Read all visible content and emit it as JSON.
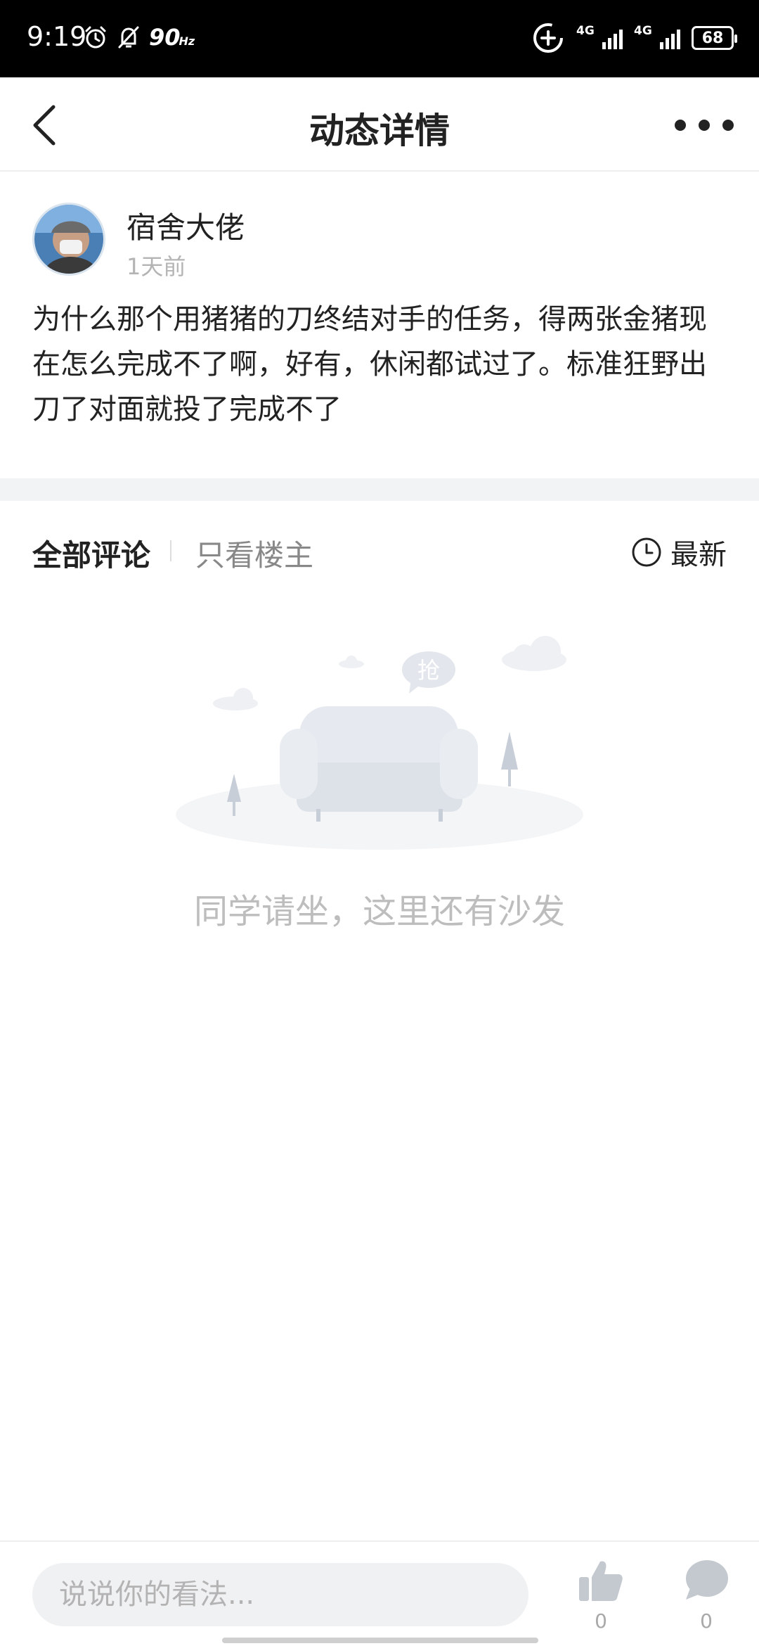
{
  "status_bar": {
    "time": "9:19",
    "refresh_rate": "90",
    "refresh_unit": "Hz",
    "network_1": "4G",
    "network_2": "4G",
    "battery": "68",
    "icons": [
      "alarm-icon",
      "mute-icon",
      "data-saver-icon",
      "signal-icon",
      "battery-icon"
    ]
  },
  "nav": {
    "title": "动态详情",
    "icons": [
      "back-arrow-icon",
      "more-dots-icon"
    ]
  },
  "post": {
    "author": "宿舍大佬",
    "time": "1天前",
    "content": "为什么那个用猪猪的刀终结对手的任务，得两张金猪现在怎么完成不了啊，好有，休闲都试过了。标准狂野出刀了对面就投了完成不了"
  },
  "comments": {
    "tab_all": "全部评论",
    "tab_op_only": "只看楼主",
    "sort_label": "最新",
    "empty_bubble": "抢",
    "empty_text": "同学请坐，这里还有沙发"
  },
  "bottom_bar": {
    "input_placeholder": "说说你的看法...",
    "like_count": "0",
    "comment_count": "0"
  },
  "colors": {
    "status_bar_bg": "#000000",
    "primary_text": "#222222",
    "muted_text": "#b4b4b4",
    "divider": "#f2f3f5",
    "input_bg": "#f0f1f3"
  }
}
